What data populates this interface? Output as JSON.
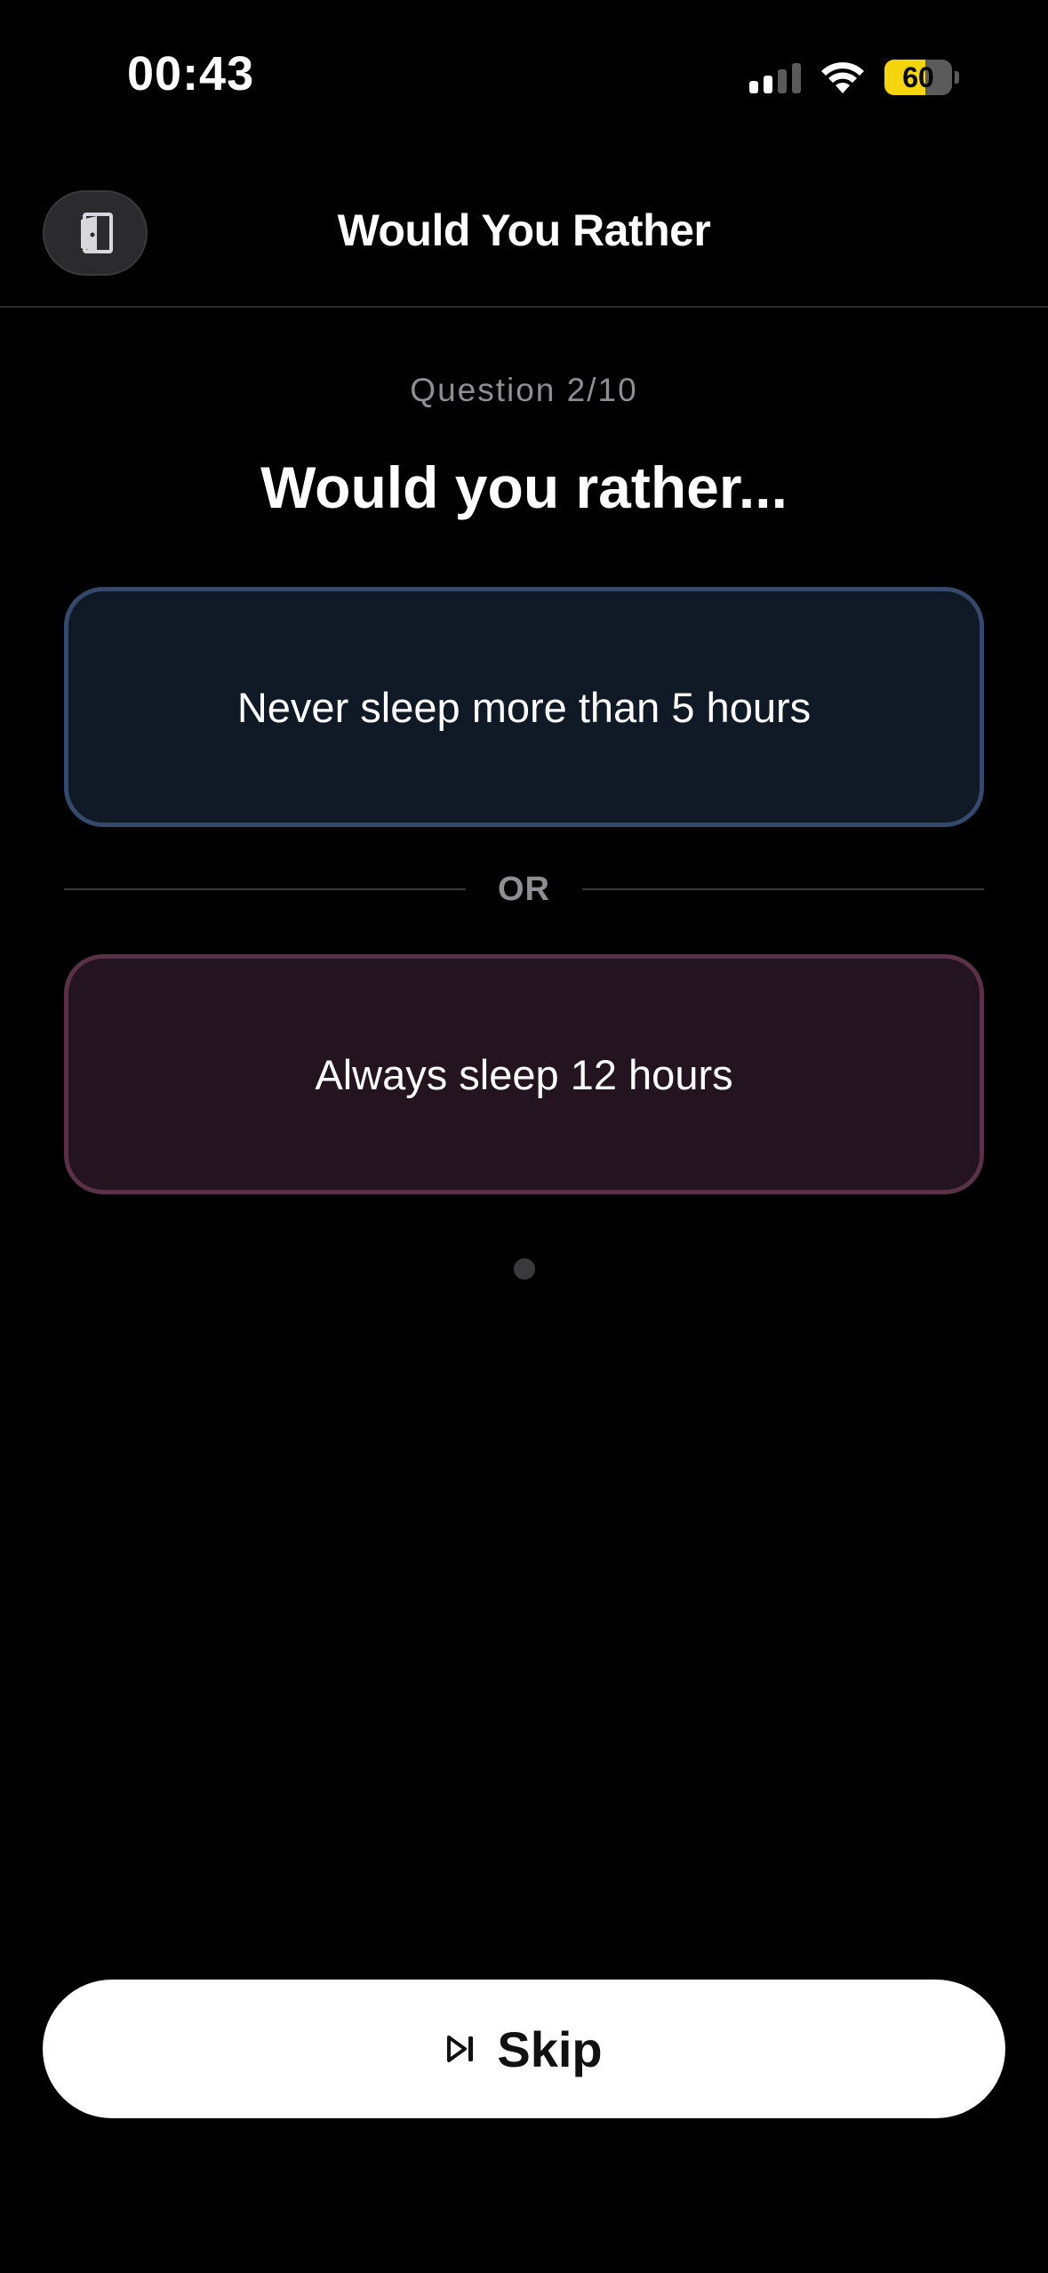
{
  "status_bar": {
    "time": "00:43",
    "battery_level": "60",
    "signal_bars_active": 2,
    "signal_bars_total": 4,
    "battery_color": "#f5d50b"
  },
  "header": {
    "title": "Would You Rather",
    "exit_icon": "door-exit-icon"
  },
  "game": {
    "question_counter": "Question 2/10",
    "prompt": "Would you rather...",
    "option_a": "Never sleep more than 5 hours",
    "option_b": "Always sleep 12 hours",
    "separator": "OR",
    "option_a_color": "#35496c",
    "option_b_color": "#5a3148"
  },
  "footer": {
    "skip_label": "Skip",
    "skip_icon": "skip-forward-icon"
  }
}
